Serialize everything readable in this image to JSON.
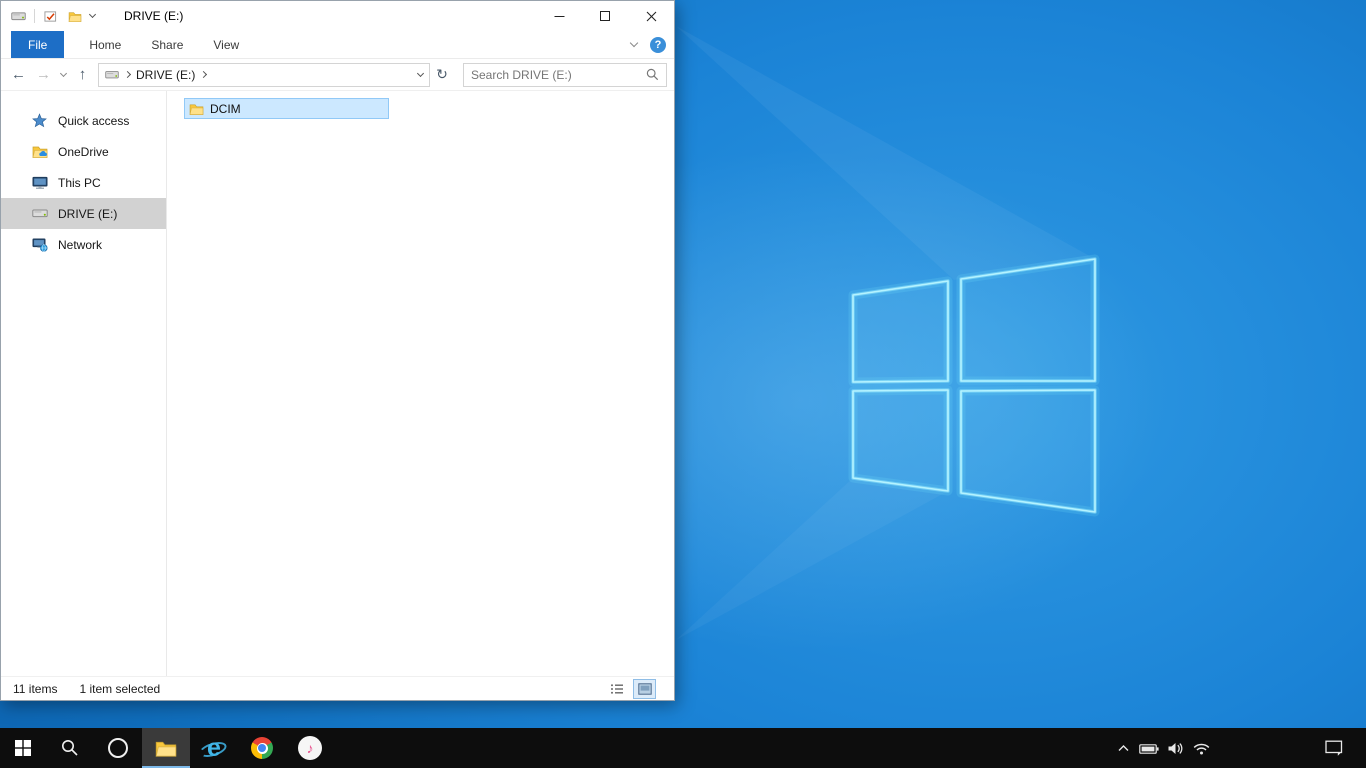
{
  "window": {
    "title": "DRIVE (E:)"
  },
  "ribbon": {
    "tabs": [
      {
        "label": "File",
        "active": true
      },
      {
        "label": "Home",
        "active": false
      },
      {
        "label": "Share",
        "active": false
      },
      {
        "label": "View",
        "active": false
      }
    ]
  },
  "navigation": {
    "back_icon": "←",
    "forward_icon": "→",
    "up_icon": "↑",
    "refresh_icon": "↻",
    "address": {
      "crumb": "DRIVE (E:)"
    },
    "search_placeholder": "Search DRIVE (E:)"
  },
  "sidebar": {
    "items": [
      {
        "label": "Quick access",
        "icon": "star-icon",
        "selected": false
      },
      {
        "label": "OneDrive",
        "icon": "onedrive-folder-icon",
        "selected": false
      },
      {
        "label": "This PC",
        "icon": "computer-icon",
        "selected": false
      },
      {
        "label": "DRIVE (E:)",
        "icon": "drive-icon",
        "selected": true
      },
      {
        "label": "Network",
        "icon": "network-icon",
        "selected": false
      }
    ]
  },
  "content": {
    "items": [
      {
        "label": "DCIM",
        "type": "folder",
        "selected": true
      }
    ]
  },
  "statusbar": {
    "total": "11 items",
    "selected": "1 item selected"
  },
  "help_icon": "?",
  "taskbar": {
    "buttons": [
      "start",
      "search",
      "cortana",
      "file-explorer",
      "internet-explorer",
      "chrome",
      "itunes"
    ],
    "tray": [
      "hidden-icons-chevron",
      "battery",
      "volume",
      "wifi",
      "action-center"
    ]
  },
  "colors": {
    "selection_fill": "#cce8ff",
    "selection_border": "#91c9f7",
    "file_tab_blue": "#1d6ec6",
    "sidebar_selected": "#d2d2d2",
    "taskbar_black": "#0d0d0d",
    "desktop_blue": "#1b83d6",
    "logo_glow": "#b5f3ff"
  }
}
